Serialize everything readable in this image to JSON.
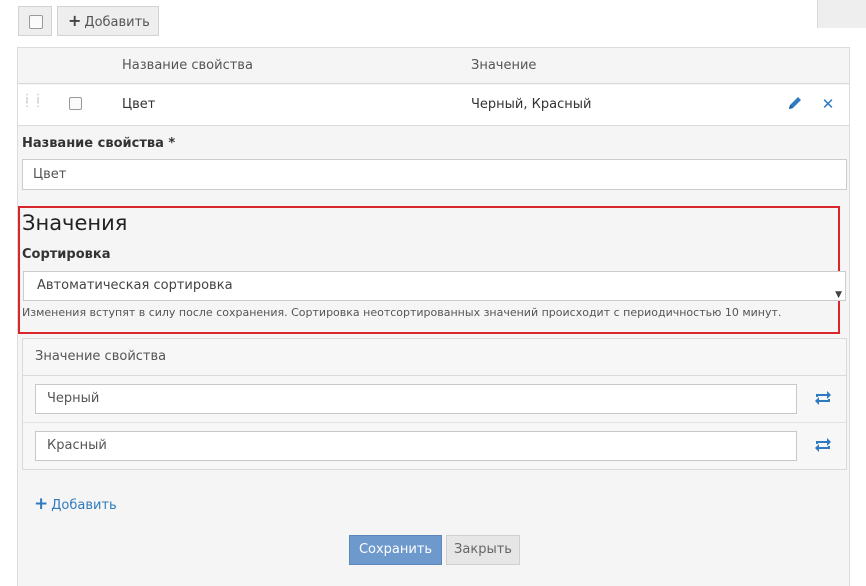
{
  "toolbar": {
    "add_label": "Добавить",
    "add_icon": "plus-icon"
  },
  "table": {
    "headers": [
      "Название свойства",
      "Значение"
    ],
    "rows": [
      {
        "name": "Цвет",
        "value": "Черный, Красный",
        "edit_icon": "pencil-icon",
        "delete_icon": "close-icon"
      }
    ]
  },
  "form": {
    "name_label": "Название свойства *",
    "name_value": "Цвет",
    "values_heading": "Значения",
    "sort_label": "Сортировка",
    "sort_selected": "Автоматическая сортировка",
    "sort_hint": "Изменения вступят в силу после сохранения. Сортировка неотсортированных значений происходит с периодичностью 10 минут.",
    "values_header": "Значение свойства",
    "values": [
      "Черный",
      "Красный"
    ],
    "add_value_label": "Добавить",
    "save_label": "Сохранить",
    "close_label": "Закрыть"
  },
  "colors": {
    "accent": "#2f7bbf",
    "primary_button": "#6e99cc",
    "highlight_border": "#d9262b"
  }
}
